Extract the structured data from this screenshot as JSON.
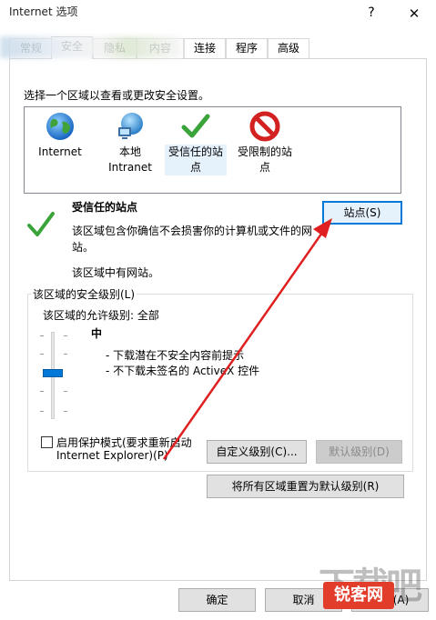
{
  "window": {
    "title": "Internet 选项",
    "help_glyph": "?",
    "close_glyph": "✕"
  },
  "tabs": [
    {
      "label": "常规"
    },
    {
      "label": "安全"
    },
    {
      "label": "隐私"
    },
    {
      "label": "内容"
    },
    {
      "label": "连接"
    },
    {
      "label": "程序"
    },
    {
      "label": "高级"
    }
  ],
  "zone_prompt": "选择一个区域以查看或更改安全设置。",
  "zones": [
    {
      "label": "Internet",
      "icon": "globe-icon"
    },
    {
      "label": "本地 Intranet",
      "icon": "intranet-globe-icon"
    },
    {
      "label": "受信任的站点",
      "icon": "check-icon"
    },
    {
      "label": "受限制的站点",
      "icon": "no-entry-icon"
    }
  ],
  "selected_zone": {
    "name": "受信任的站点",
    "description": "该区域包含你确信不会损害你的计算机或文件的网站。",
    "sites_note": "该区域中有网站。",
    "sites_button": "站点(S)"
  },
  "security_level": {
    "group_label": "该区域的安全级别(L)",
    "allowed": "该区域的允许级别: 全部",
    "level_name": "中",
    "details": [
      "- 下载潜在不安全内容前提示",
      "- 不下载未签名的 ActiveX 控件"
    ],
    "slider_level": 0.5,
    "protected_mode": {
      "label_line1": "启用保护模式(要求重新启动",
      "label_line2": "Internet Explorer)(P)",
      "checked": false
    },
    "custom_button": "自定义级别(C)...",
    "default_button": "默认级别(D)",
    "reset_all_button": "将所有区域重置为默认级别(R)"
  },
  "footer": {
    "ok": "确定",
    "cancel": "取消",
    "apply": "应用(A)"
  },
  "watermark": {
    "big": "下载吧",
    "badge": "锐客网"
  },
  "colors": {
    "accent": "#0078d7",
    "annotation_arrow": "#e02020",
    "check_green": "#3aa43a"
  }
}
